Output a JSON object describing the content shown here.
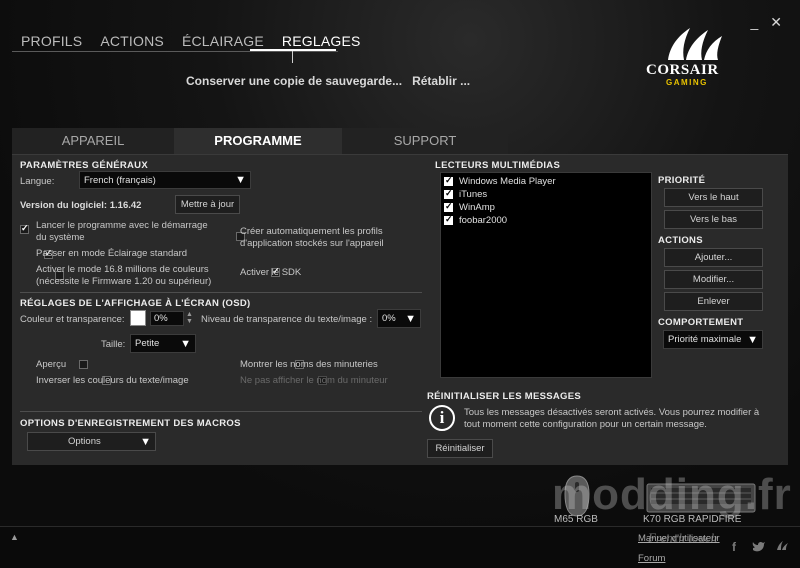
{
  "window": {
    "minimize": "_",
    "close": "✕"
  },
  "nav": {
    "tabs": [
      "PROFILS",
      "ACTIONS",
      "ÉCLAIRAGE",
      "REGLAGES"
    ],
    "active": 3
  },
  "backup": {
    "keep": "Conserver une copie de sauvegarde...",
    "restore": "Rétablir ..."
  },
  "logo": {
    "word": "CORSAIR",
    "sub": "GAMING"
  },
  "subtabs": {
    "items": [
      "APPAREIL",
      "PROGRAMME",
      "SUPPORT"
    ],
    "active": 1
  },
  "general": {
    "title": "PARAMÈTRES GÉNÉRAUX",
    "language_label": "Langue:",
    "language_value": "French (français)",
    "version": "Version du logiciel: 1.16.42",
    "update_button": "Mettre à jour",
    "opt_launch": "Lancer le programme avec le démarrage du système",
    "opt_launch_line1": "Lancer le programme avec le démarrage",
    "opt_launch_line2": "du système",
    "opt_standard": "Passer en mode Éclairage standard",
    "opt_16m_line1": "Activer le mode 16.8 millions de couleurs",
    "opt_16m_line2": "(nécessite le Firmware 1.20 ou supérieur)",
    "opt_profiles_line1": "Créer automatiquement les profils",
    "opt_profiles_line2": "d'application stockés sur l'appareil",
    "opt_sdk": "Activer le SDK"
  },
  "osd": {
    "title": "RÉGLAGES DE L'AFFICHAGE À L'ÉCRAN (OSD)",
    "color_label": "Couleur et transparence:",
    "color_value": "0%",
    "text_transparency_label": "Niveau de transparence du texte/image :",
    "text_transparency_value": "0%",
    "size_label": "Taille:",
    "size_value": "Petite",
    "preview": "Aperçu",
    "show_timers": "Montrer les noms des minuteries",
    "invert": "Inverser les couleurs du texte/image",
    "hide_timer": "Ne pas afficher le nom du minuteur"
  },
  "macros": {
    "title": "OPTIONS D'ENREGISTREMENT DES MACROS",
    "options_button": "Options"
  },
  "media": {
    "title": "LECTEURS MULTIMÉDIAS",
    "players": [
      "Windows Media Player",
      "iTunes",
      "WinAmp",
      "foobar2000"
    ],
    "priority_title": "PRIORITÉ",
    "up": "Vers le haut",
    "down": "Vers le bas",
    "actions_title": "ACTIONS",
    "add": "Ajouter...",
    "modify": "Modifier...",
    "remove": "Enlever",
    "behavior_title": "COMPORTEMENT",
    "behavior_value": "Priorité maximale"
  },
  "reset": {
    "title": "RÉINITIALISER LES MESSAGES",
    "message_line1": "Tous les messages désactivés seront activés. Vous pourrez modifier à",
    "message_line2": "tout moment cette configuration pour un certain message.",
    "button": "Réinitialiser"
  },
  "devices": [
    "M65 RGB",
    "K70 RGB RAPIDFIRE"
  ],
  "links": {
    "manual": "Manuel d'utilisateur",
    "forum": "Forum"
  },
  "watermark": {
    "main": "modding.fr",
    "sub": "French touch"
  },
  "social": [
    "f",
    "t",
    "corsair"
  ],
  "bottom_arrow": "▲"
}
